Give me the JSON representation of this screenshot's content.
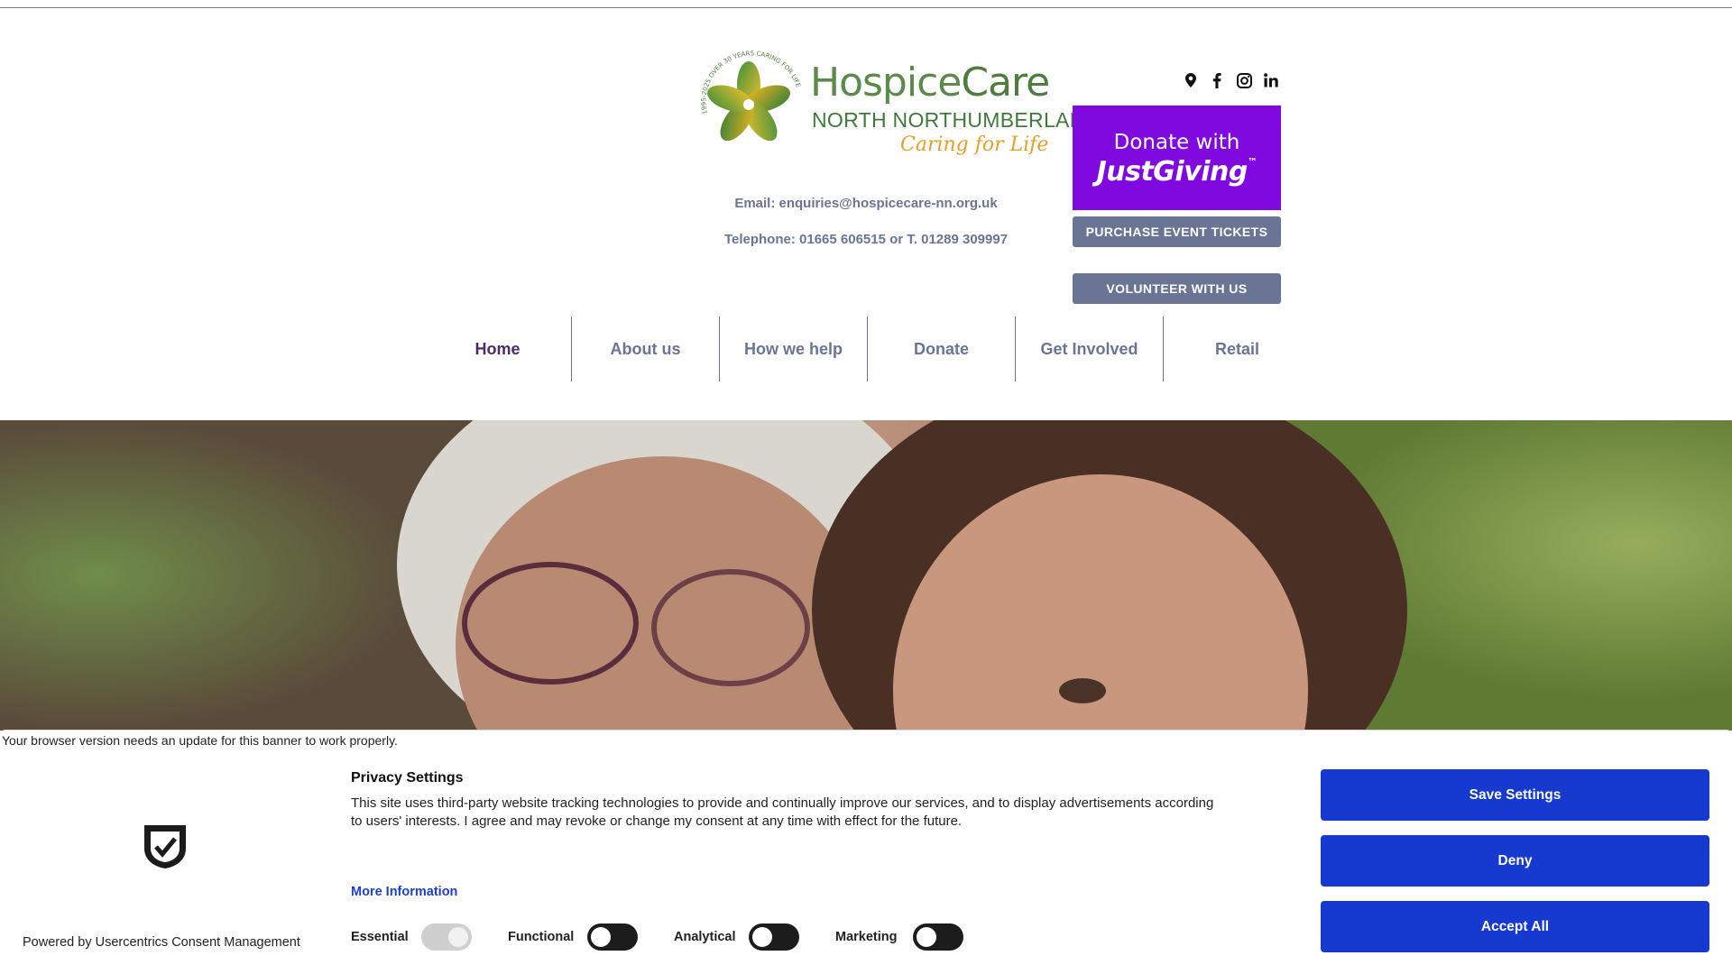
{
  "header": {
    "logo": {
      "ring_text": "1995-2025 OVER 30 YEARS CARING FOR LIFE",
      "name_part1": "Hospice",
      "name_part2": "Care",
      "subtitle": "NORTH NORTHUMBERLAND",
      "tagline": "Caring for Life"
    },
    "email_line": "Email: enquiries@hospicecare-nn.org.uk",
    "phone_line": "Telephone: 01665 606515 or T. 01289 309997",
    "social": [
      "location-pin-icon",
      "facebook-icon",
      "instagram-icon",
      "linkedin-icon"
    ],
    "donate_banner": {
      "line1": "Donate with",
      "line2": "JustGiving",
      "tm": "™"
    },
    "buttons": {
      "tickets": "PURCHASE EVENT TICKETS",
      "volunteer": "VOLUNTEER WITH US"
    }
  },
  "nav": {
    "items": [
      {
        "label": "Home",
        "active": true
      },
      {
        "label": "About us"
      },
      {
        "label": "How we help"
      },
      {
        "label": "Donate"
      },
      {
        "label": "Get Involved"
      },
      {
        "label": "Retail"
      }
    ]
  },
  "colors": {
    "nav_text": "#6a7596",
    "nav_active": "#4a2a6a",
    "justgiving": "#8009e0",
    "consent_button": "#1639cf"
  },
  "consent": {
    "warning": "Your browser version needs an update for this banner to work properly.",
    "powered_by": "Powered by Usercentrics Consent Management",
    "title": "Privacy Settings",
    "text": "This site uses third-party website tracking technologies to provide and continually improve our services, and to display advertisements according to users' interests. I agree and may revoke or change my consent at any time with effect for the future.",
    "more_info": "More Information",
    "toggles": [
      {
        "label": "Essential",
        "state": "on-disabled"
      },
      {
        "label": "Functional",
        "state": "off"
      },
      {
        "label": "Analytical",
        "state": "off"
      },
      {
        "label": "Marketing",
        "state": "off"
      }
    ],
    "buttons": {
      "save": "Save Settings",
      "deny": "Deny",
      "accept": "Accept All"
    }
  }
}
